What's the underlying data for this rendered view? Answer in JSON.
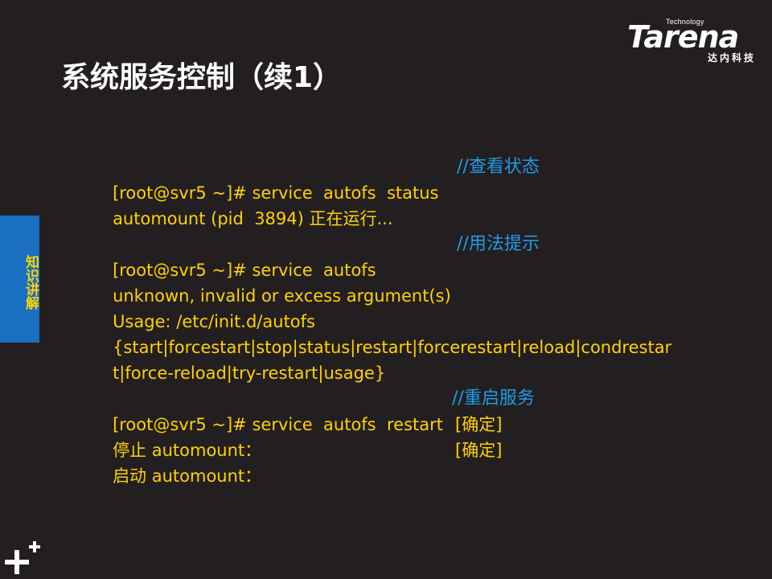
{
  "logo": {
    "word": "Tarena",
    "technology": "Technology",
    "cn": "达内科技"
  },
  "title": "系统服务控制（续1）",
  "side_tab": "知识讲解",
  "lines": {
    "l1_cmd": "[root@svr5 ~]# service  autofs  status",
    "l1_comment": "//查看状态",
    "l2": "automount (pid  3894) 正在运行...",
    "l3_cmd": "[root@svr5 ~]# service  autofs",
    "l3_comment": "//用法提示",
    "l4": "unknown, invalid or excess argument(s)",
    "l5": "Usage: /etc/init.d/autofs",
    "l6": "{start|forcestart|stop|status|restart|forcerestart|reload|condrestar",
    "l7": "t|force-reload|try-restart|usage}",
    "l8_cmd": "[root@svr5 ~]# service  autofs  restart",
    "l8_comment": "//重启服务",
    "l9_text": "停止 automount：",
    "l9_result": "[确定]",
    "l10_text": "启动 automount：",
    "l10_result": "[确定]"
  },
  "colors": {
    "background": "#231f20",
    "text_yellow": "#ffd200",
    "comment_blue": "#1e9be8",
    "tab_blue": "#1a6fc0"
  }
}
